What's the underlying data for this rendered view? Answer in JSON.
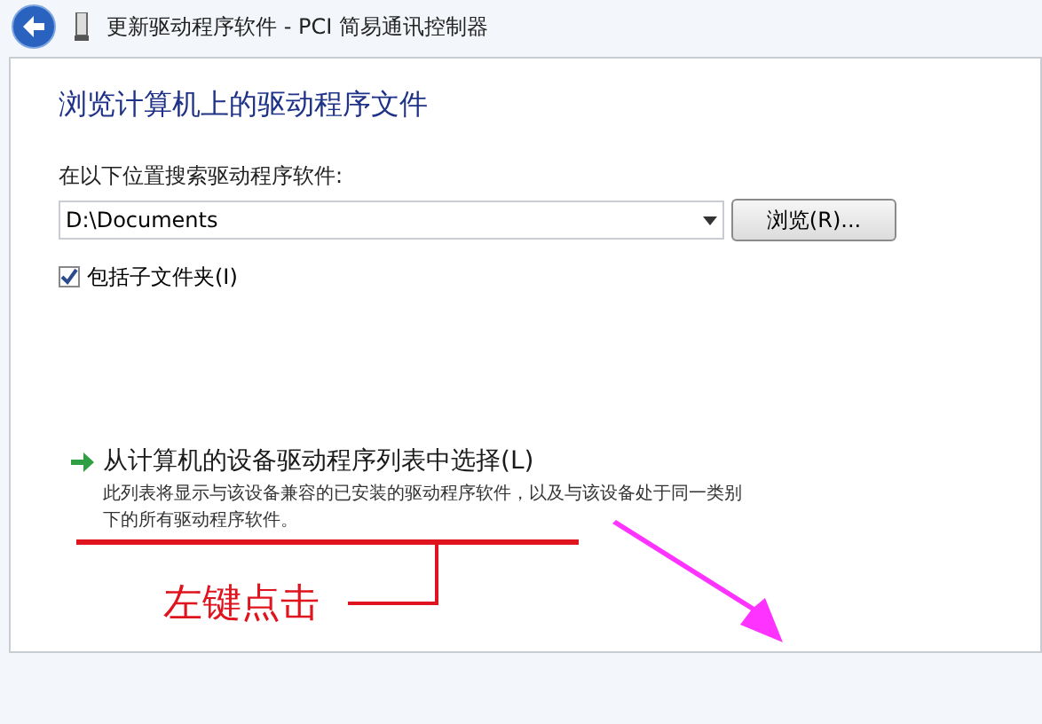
{
  "window": {
    "title": "更新驱动程序软件 - PCI 简易通讯控制器"
  },
  "heading": "浏览计算机上的驱动程序文件",
  "search_label": "在以下位置搜索驱动程序软件:",
  "path_field": {
    "value": "D:\\Documents"
  },
  "browse_button": "浏览(R)...",
  "include_subfolders": {
    "label": "包括子文件夹(I)",
    "checked": true
  },
  "pick_option": {
    "title": "从计算机的设备驱动程序列表中选择(L)",
    "description": "此列表将显示与该设备兼容的已安装的驱动程序软件，以及与该设备处于同一类别下的所有驱动程序软件。"
  },
  "annotation": {
    "text": "左键点击"
  }
}
